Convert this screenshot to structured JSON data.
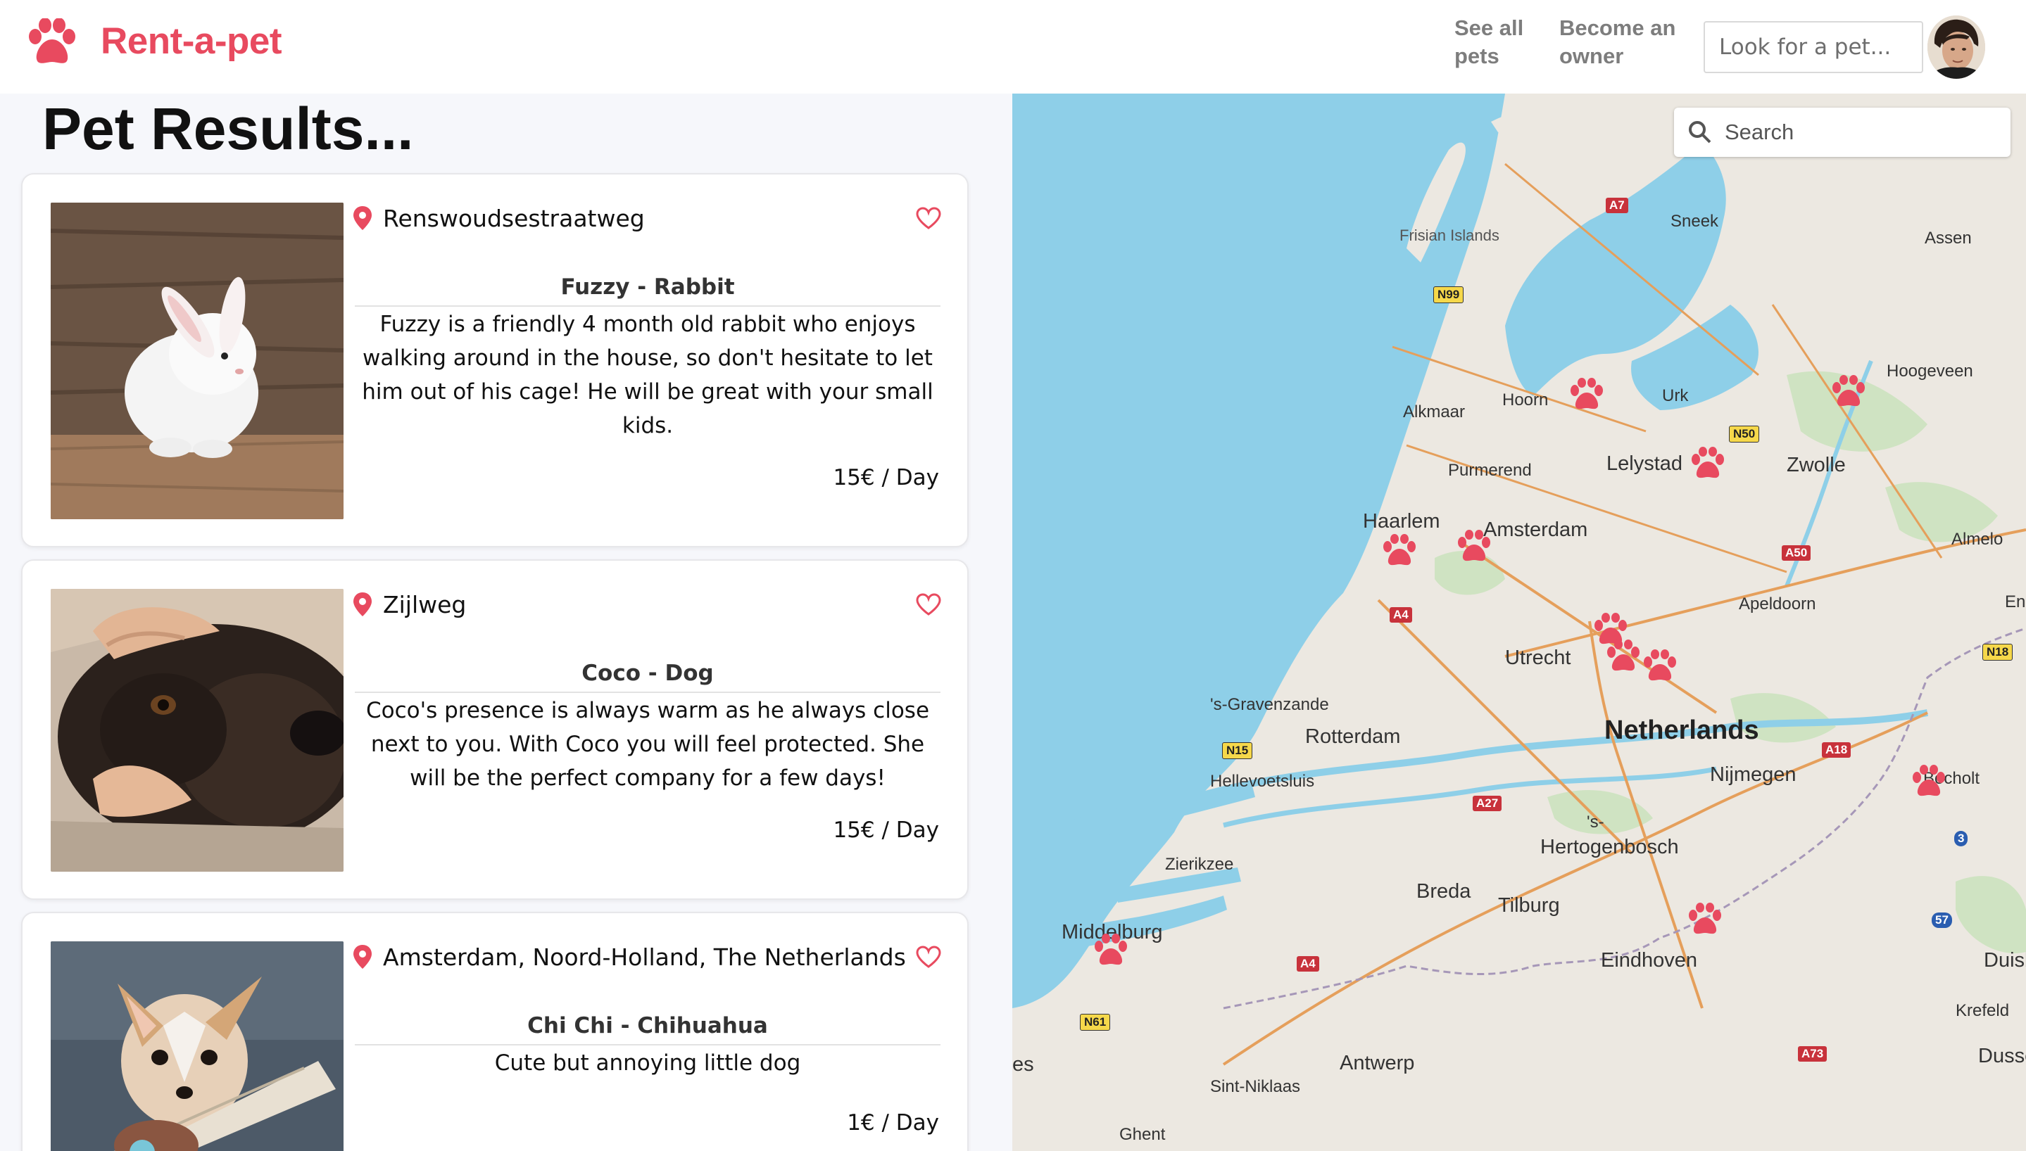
{
  "navbar": {
    "brand": "Rent-a-pet",
    "links": [
      "See all\npets",
      "Become an\nowner"
    ],
    "search_placeholder": "Look for a pet..."
  },
  "results": {
    "title": "Pet Results...",
    "pets": [
      {
        "location": "Renswoudsestraatweg",
        "name": "Fuzzy - Rabbit",
        "description": "Fuzzy is a friendly 4 month old rabbit who enjoys walking around in the house, so don't hesitate to let him out of his cage! He will be great with your small kids.",
        "price": "15€ / Day"
      },
      {
        "location": "Zijlweg",
        "name": "Coco - Dog",
        "description": "Coco's presence is always warm as he always close next to you. With Coco you will feel protected. She will be the perfect company for a few days!",
        "price": "15€ / Day"
      },
      {
        "location": "Amsterdam, Noord-Holland, The Netherlands",
        "name": "Chi Chi - Chihuahua",
        "description": "Cute but annoying little dog",
        "price": "1€ / Day"
      }
    ]
  },
  "map": {
    "search_placeholder": "Search",
    "labels": {
      "frisian": "Frisian Islands",
      "sneek": "Sneek",
      "assen": "Assen",
      "hoogeveen": "Hoogeveen",
      "hoorn": "Hoorn",
      "urk": "Urk",
      "alkmaar": "Alkmaar",
      "purmerend": "Purmerend",
      "lelystad": "Lelystad",
      "zwolle": "Zwolle",
      "haarlem": "Haarlem",
      "amsterdam": "Amsterdam",
      "almelo": "Almelo",
      "apeldoorn": "Apeldoorn",
      "en": "En",
      "utrecht": "Utrecht",
      "gravenzande": "'s-Gravenzande",
      "netherlands": "Netherlands",
      "rotterdam": "Rotterdam",
      "hellevoetsluis": "Hellevoetsluis",
      "nijmegen": "Nijmegen",
      "bocholt": "Bocholt",
      "s": "'s-",
      "hertogenbosch": "Hertogenbosch",
      "zierikzee": "Zierikzee",
      "breda": "Breda",
      "tilburg": "Tilburg",
      "middelburg": "Middelburg",
      "eindhoven": "Eindhoven",
      "duisbu": "Duisbu",
      "krefeld": "Krefeld",
      "es": "es",
      "antwerp": "Antwerp",
      "dussel": "Dussel",
      "sintniklaas": "Sint-Niklaas",
      "ghent": "Ghent"
    },
    "roads": {
      "a7": "A7",
      "n99": "N99",
      "n50": "N50",
      "a50": "A50",
      "a4a": "A4",
      "n18": "N18",
      "n15": "N15",
      "a18": "A18",
      "a27": "A27",
      "r3": "3",
      "r57": "57",
      "a4b": "A4",
      "n61": "N61",
      "a73": "A73"
    }
  },
  "colors": {
    "accent": "#e84a5f",
    "nav_link": "#7d7d7d",
    "water": "#8ecfe8",
    "land": "#ece8e1"
  }
}
